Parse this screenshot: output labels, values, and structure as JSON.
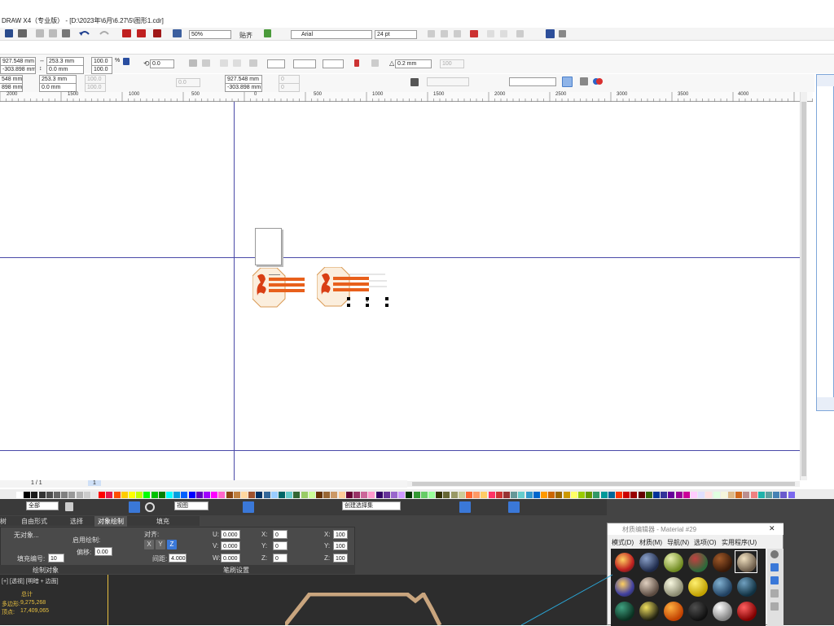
{
  "window": {
    "title": "DRAW X4（专业版） - [D:\\2023年\\6月\\6.27\\5\\图形1.cdr]"
  },
  "toolbar": {
    "zoom": "50%",
    "snap_label": "贴齐",
    "font_name": "Arial",
    "font_size": "24 pt"
  },
  "propbar1": {
    "x_pos": "927.548 mm",
    "y_pos": "-303.898 mm",
    "width": "253.3 mm",
    "height": "0.0 mm",
    "scale_x": "100.0",
    "scale_y": "100.0",
    "pct": "%",
    "angle": "0.0",
    "outline_width": "0.2 mm",
    "value_100": "100"
  },
  "propbar2": {
    "x_pos": "548 mm",
    "y_pos": "898 mm",
    "width": "253.3 mm",
    "height": "0.0 mm",
    "scale_x": "100.0",
    "scale_y": "100.0",
    "angle": "0.0",
    "x_pos2": "927.548 mm",
    "y_pos2": "-303.898 mm",
    "n1": "0",
    "n2": "0"
  },
  "ruler": {
    "ticks": [
      "2000",
      "1500",
      "1000",
      "500",
      "0",
      "500",
      "1000",
      "1500",
      "2000",
      "2500",
      "3000",
      "3500",
      "4000"
    ]
  },
  "page_nav": {
    "text": "1 / 1",
    "page": "1"
  },
  "max": {
    "tabs": [
      "自由形式",
      "选择",
      "对象绘制",
      "填充"
    ],
    "tab0": "树",
    "filter_all": "全部",
    "view": "视图",
    "create_sel": "创建选择集",
    "no_object": "无对象...",
    "fill_number": "填充编号:",
    "fill_number_val": "10",
    "enable_paint": "启用绘制:",
    "offset": "偏移:",
    "offset_val": "0.00",
    "align": "对齐:",
    "spacing": "间距:",
    "spacing_val": "4.000",
    "x": "X",
    "y": "Y",
    "z": "Z",
    "u": "U:",
    "v": "V:",
    "w": "W:",
    "u_val": "0.000",
    "v_val": "0.000",
    "w_val": "0.000",
    "rx": "X:",
    "ry": "Y:",
    "rz": "Z:",
    "rx_val": "0",
    "ry_val": "0",
    "rz_val": "0",
    "sx": "X:",
    "sy": "Y:",
    "sz": "Z:",
    "sx_val": "100",
    "sy_val": "100",
    "sz_val": "100",
    "section_object": "绘制对象",
    "section_brush": "笔刷设置",
    "viewport_label": "[+] [透视] [明暗 + 边面]",
    "stats_total": "总计",
    "stats_polys_label": "多边形:",
    "stats_polys": "9,275,268",
    "stats_verts_label": "顶点:",
    "stats_verts": "17,409,065"
  },
  "material_editor": {
    "title": "材质编辑器 - Material #29",
    "menu": [
      "模式(D)",
      "材质(M)",
      "导航(N)",
      "选项(O)",
      "实用程序(U)"
    ]
  },
  "colors": {
    "accent_orange": "#e8601c",
    "selection_blue": "#3a6fd8",
    "max_bg": "#444444",
    "guide": "#4a4aa8"
  }
}
